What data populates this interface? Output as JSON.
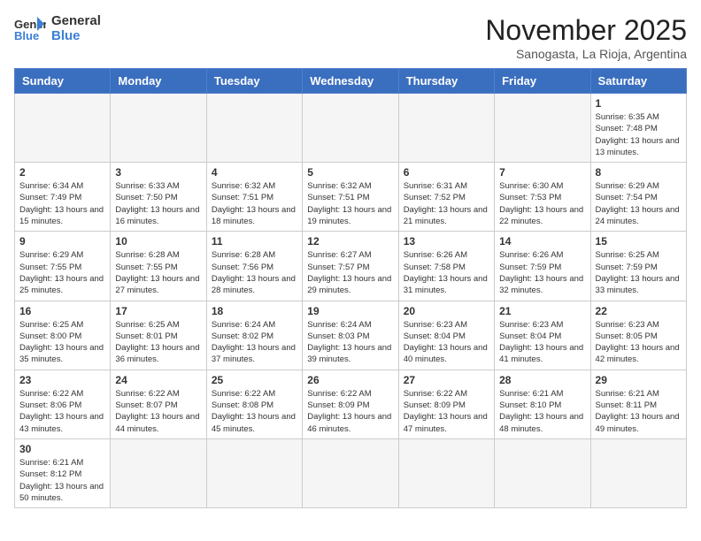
{
  "header": {
    "logo_text_general": "General",
    "logo_text_blue": "Blue",
    "month_title": "November 2025",
    "subtitle": "Sanogasta, La Rioja, Argentina"
  },
  "days_of_week": [
    "Sunday",
    "Monday",
    "Tuesday",
    "Wednesday",
    "Thursday",
    "Friday",
    "Saturday"
  ],
  "weeks": [
    [
      {
        "num": "",
        "info": ""
      },
      {
        "num": "",
        "info": ""
      },
      {
        "num": "",
        "info": ""
      },
      {
        "num": "",
        "info": ""
      },
      {
        "num": "",
        "info": ""
      },
      {
        "num": "",
        "info": ""
      },
      {
        "num": "1",
        "info": "Sunrise: 6:35 AM\nSunset: 7:48 PM\nDaylight: 13 hours and 13 minutes."
      }
    ],
    [
      {
        "num": "2",
        "info": "Sunrise: 6:34 AM\nSunset: 7:49 PM\nDaylight: 13 hours and 15 minutes."
      },
      {
        "num": "3",
        "info": "Sunrise: 6:33 AM\nSunset: 7:50 PM\nDaylight: 13 hours and 16 minutes."
      },
      {
        "num": "4",
        "info": "Sunrise: 6:32 AM\nSunset: 7:51 PM\nDaylight: 13 hours and 18 minutes."
      },
      {
        "num": "5",
        "info": "Sunrise: 6:32 AM\nSunset: 7:51 PM\nDaylight: 13 hours and 19 minutes."
      },
      {
        "num": "6",
        "info": "Sunrise: 6:31 AM\nSunset: 7:52 PM\nDaylight: 13 hours and 21 minutes."
      },
      {
        "num": "7",
        "info": "Sunrise: 6:30 AM\nSunset: 7:53 PM\nDaylight: 13 hours and 22 minutes."
      },
      {
        "num": "8",
        "info": "Sunrise: 6:29 AM\nSunset: 7:54 PM\nDaylight: 13 hours and 24 minutes."
      }
    ],
    [
      {
        "num": "9",
        "info": "Sunrise: 6:29 AM\nSunset: 7:55 PM\nDaylight: 13 hours and 25 minutes."
      },
      {
        "num": "10",
        "info": "Sunrise: 6:28 AM\nSunset: 7:55 PM\nDaylight: 13 hours and 27 minutes."
      },
      {
        "num": "11",
        "info": "Sunrise: 6:28 AM\nSunset: 7:56 PM\nDaylight: 13 hours and 28 minutes."
      },
      {
        "num": "12",
        "info": "Sunrise: 6:27 AM\nSunset: 7:57 PM\nDaylight: 13 hours and 29 minutes."
      },
      {
        "num": "13",
        "info": "Sunrise: 6:26 AM\nSunset: 7:58 PM\nDaylight: 13 hours and 31 minutes."
      },
      {
        "num": "14",
        "info": "Sunrise: 6:26 AM\nSunset: 7:59 PM\nDaylight: 13 hours and 32 minutes."
      },
      {
        "num": "15",
        "info": "Sunrise: 6:25 AM\nSunset: 7:59 PM\nDaylight: 13 hours and 33 minutes."
      }
    ],
    [
      {
        "num": "16",
        "info": "Sunrise: 6:25 AM\nSunset: 8:00 PM\nDaylight: 13 hours and 35 minutes."
      },
      {
        "num": "17",
        "info": "Sunrise: 6:25 AM\nSunset: 8:01 PM\nDaylight: 13 hours and 36 minutes."
      },
      {
        "num": "18",
        "info": "Sunrise: 6:24 AM\nSunset: 8:02 PM\nDaylight: 13 hours and 37 minutes."
      },
      {
        "num": "19",
        "info": "Sunrise: 6:24 AM\nSunset: 8:03 PM\nDaylight: 13 hours and 39 minutes."
      },
      {
        "num": "20",
        "info": "Sunrise: 6:23 AM\nSunset: 8:04 PM\nDaylight: 13 hours and 40 minutes."
      },
      {
        "num": "21",
        "info": "Sunrise: 6:23 AM\nSunset: 8:04 PM\nDaylight: 13 hours and 41 minutes."
      },
      {
        "num": "22",
        "info": "Sunrise: 6:23 AM\nSunset: 8:05 PM\nDaylight: 13 hours and 42 minutes."
      }
    ],
    [
      {
        "num": "23",
        "info": "Sunrise: 6:22 AM\nSunset: 8:06 PM\nDaylight: 13 hours and 43 minutes."
      },
      {
        "num": "24",
        "info": "Sunrise: 6:22 AM\nSunset: 8:07 PM\nDaylight: 13 hours and 44 minutes."
      },
      {
        "num": "25",
        "info": "Sunrise: 6:22 AM\nSunset: 8:08 PM\nDaylight: 13 hours and 45 minutes."
      },
      {
        "num": "26",
        "info": "Sunrise: 6:22 AM\nSunset: 8:09 PM\nDaylight: 13 hours and 46 minutes."
      },
      {
        "num": "27",
        "info": "Sunrise: 6:22 AM\nSunset: 8:09 PM\nDaylight: 13 hours and 47 minutes."
      },
      {
        "num": "28",
        "info": "Sunrise: 6:21 AM\nSunset: 8:10 PM\nDaylight: 13 hours and 48 minutes."
      },
      {
        "num": "29",
        "info": "Sunrise: 6:21 AM\nSunset: 8:11 PM\nDaylight: 13 hours and 49 minutes."
      }
    ],
    [
      {
        "num": "30",
        "info": "Sunrise: 6:21 AM\nSunset: 8:12 PM\nDaylight: 13 hours and 50 minutes."
      },
      {
        "num": "",
        "info": ""
      },
      {
        "num": "",
        "info": ""
      },
      {
        "num": "",
        "info": ""
      },
      {
        "num": "",
        "info": ""
      },
      {
        "num": "",
        "info": ""
      },
      {
        "num": "",
        "info": ""
      }
    ]
  ]
}
